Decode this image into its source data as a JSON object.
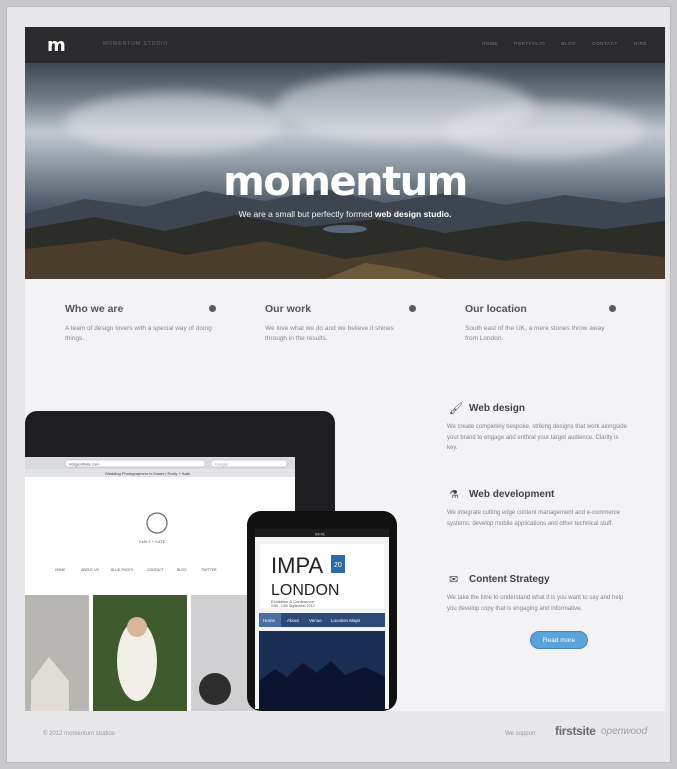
{
  "nav": {
    "logo": "m",
    "tagline": "MOMENTUM STUDIO",
    "links": [
      "Home",
      "Portfolio",
      "Blog",
      "Contact",
      "Hire"
    ]
  },
  "hero": {
    "title": "momentum",
    "subtitle_plain": "We are a small but perfectly formed ",
    "subtitle_bold": "web design studio."
  },
  "features": [
    {
      "title": "Who we are",
      "text": "A team of design lovers with a special way of doing things."
    },
    {
      "title": "Our work",
      "text": "We love what we do and we believe it shines through in the results."
    },
    {
      "title": "Our location",
      "text": "South east of the UK, a mere stones throw away from London."
    }
  ],
  "services": [
    {
      "icon": "brush-icon",
      "glyph": "🖌",
      "title": "Web design",
      "text": "We create completely bespoke, striking designs that work alongside your brand to engage and enthral your target audience. Clarity is key."
    },
    {
      "icon": "flask-icon",
      "glyph": "⚗",
      "title": "Web development",
      "text": "We integrate cutting edge content management and e-commerce systems, develop mobile applications and other technical stuff."
    },
    {
      "icon": "chat-icon",
      "glyph": "✉",
      "title": "Content Strategy",
      "text": "We take the time to understand what it is you want to say and help you develop copy that is engaging and informative."
    }
  ],
  "read_more": "Read more",
  "tablet": {
    "url": "instgenifrate.com",
    "search_placeholder": "Google",
    "page_title": "Wedding Photographers in Essex | Emily + Kate",
    "site_name": "EMILY + KATE",
    "nav": [
      "HOME",
      "ABOUT US",
      "BLUE PHOTO",
      "CONTACT",
      "BLOG",
      "TWITTER"
    ]
  },
  "phone": {
    "time": "09:41",
    "impa": "IMPA",
    "london": "LONDON",
    "badge": "20",
    "tagline": "Exhibition & Conference",
    "dates": "10th - 13th September 2012",
    "nav": [
      "Home",
      "About",
      "Venue",
      "Location Maps"
    ]
  },
  "footer": {
    "copyright": "© 2012 momentum studios",
    "support_label": "We support",
    "sponsor1": "firstsite",
    "sponsor2": "openwood"
  },
  "colors": {
    "nav_bg": "#2b2b2d",
    "accent": "#5aa4da",
    "heading": "#555555"
  }
}
